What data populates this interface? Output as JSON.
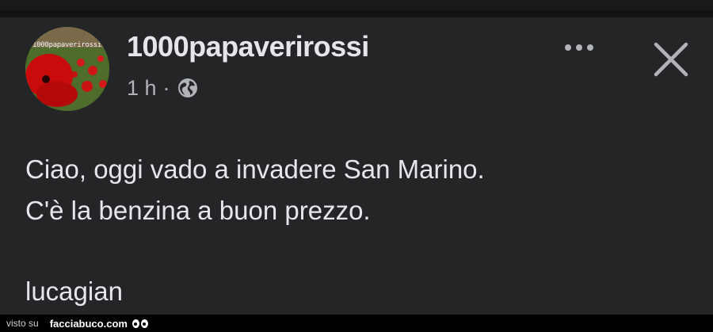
{
  "post": {
    "author": "1000papaverirossi",
    "avatar_text": "1000papaverirossi",
    "time": "1 h",
    "separator": "·",
    "privacy_icon": "globe-icon",
    "body_lines": [
      "Ciao, oggi vado a invadere San Marino.",
      "C'è la benzina a buon prezzo."
    ],
    "signature": "lucagian"
  },
  "actions": {
    "more_icon": "more-horizontal-icon",
    "close_icon": "close-icon"
  },
  "footer": {
    "visto_label": "visto su",
    "brand": "facciabuco.com"
  },
  "colors": {
    "background": "#242526",
    "text_primary": "#e4e6eb",
    "text_secondary": "#b0b3b8"
  }
}
